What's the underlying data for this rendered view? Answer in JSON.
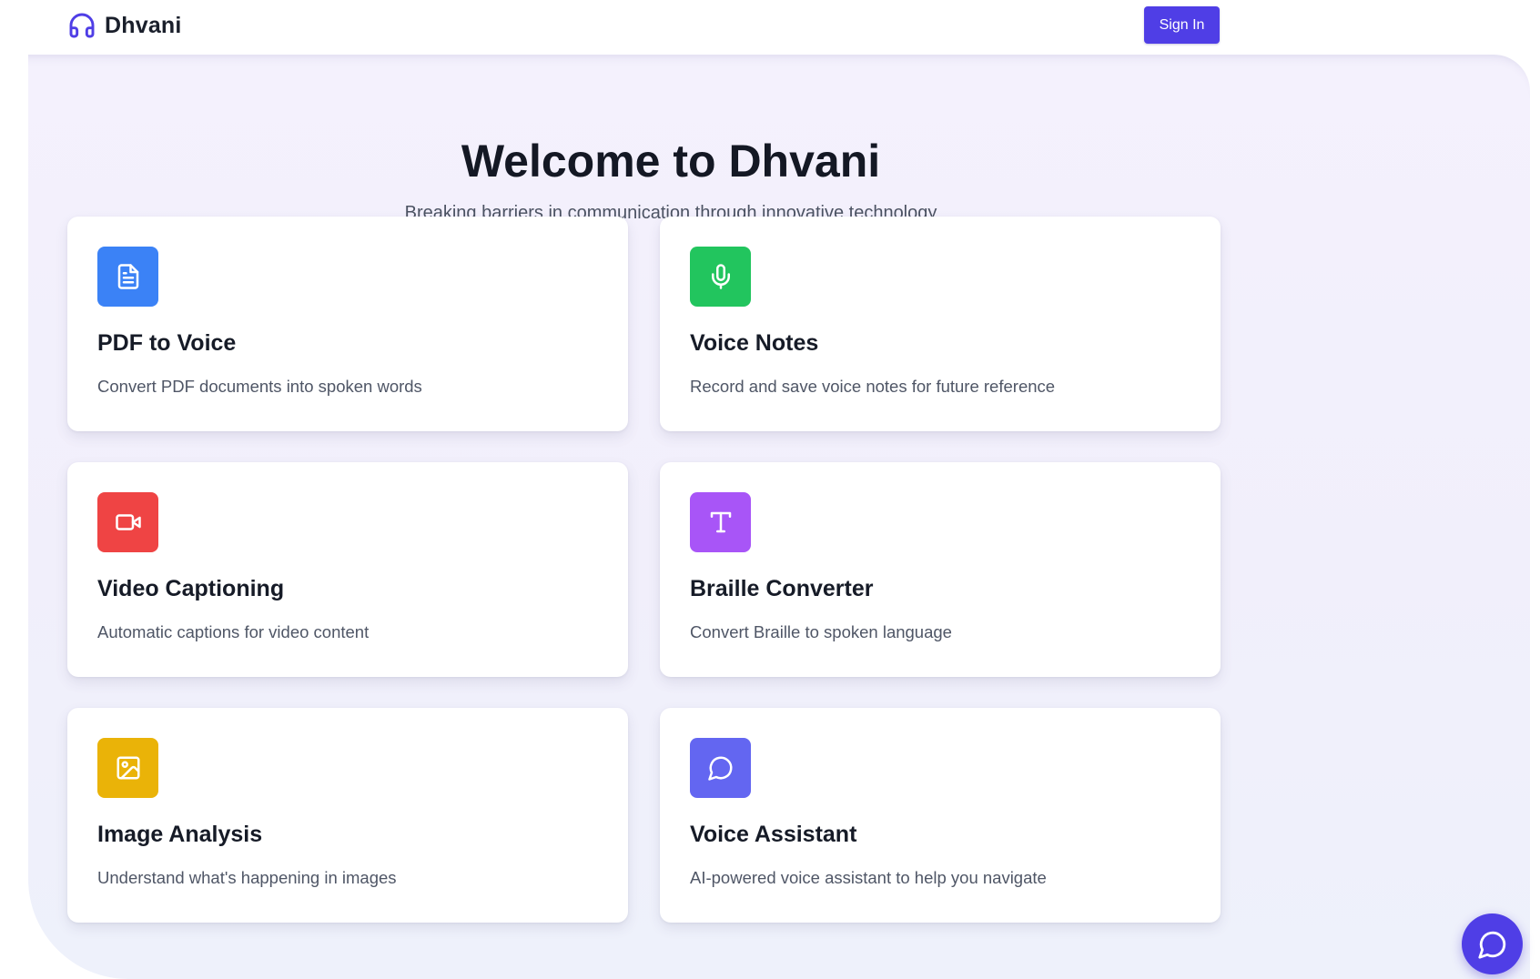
{
  "header": {
    "brand_name": "Dhvani",
    "brand_icon": "headphones-icon",
    "signin_label": "Sign In"
  },
  "hero": {
    "title": "Welcome to Dhvani",
    "subtitle": "Breaking barriers in communication through innovative technology"
  },
  "colors": {
    "primary": "#4f3ee6",
    "pdf": "#3b82f6",
    "voice_notes": "#22c55e",
    "video": "#ef4444",
    "braille": "#a855f7",
    "image": "#eab308",
    "assistant": "#6366f1"
  },
  "features": [
    {
      "title": "PDF to Voice",
      "description": "Convert PDF documents into spoken words",
      "icon": "file-text-icon",
      "color": "#3b82f6"
    },
    {
      "title": "Voice Notes",
      "description": "Record and save voice notes for future reference",
      "icon": "microphone-icon",
      "color": "#22c55e"
    },
    {
      "title": "Video Captioning",
      "description": "Automatic captions for video content",
      "icon": "video-camera-icon",
      "color": "#ef4444"
    },
    {
      "title": "Braille Converter",
      "description": "Convert Braille to spoken language",
      "icon": "type-icon",
      "color": "#a855f7"
    },
    {
      "title": "Image Analysis",
      "description": "Understand what's happening in images",
      "icon": "image-icon",
      "color": "#eab308"
    },
    {
      "title": "Voice Assistant",
      "description": "AI-powered voice assistant to help you navigate",
      "icon": "message-circle-icon",
      "color": "#6366f1"
    }
  ],
  "chat_fab": {
    "icon": "message-circle-icon"
  }
}
